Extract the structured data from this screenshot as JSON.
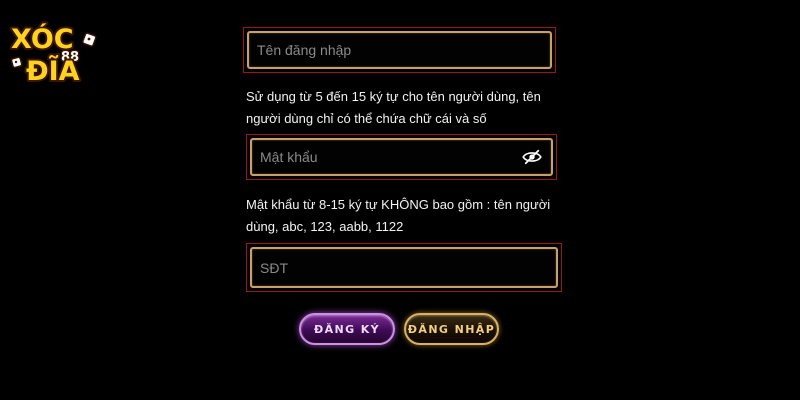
{
  "brand": {
    "logo_line1": "XÓC",
    "logo_badge": "88",
    "logo_line2": "ĐĨA"
  },
  "form": {
    "username": {
      "placeholder": "Tên đăng nhập",
      "value": "",
      "hint": "Sử dụng từ 5 đến 15 ký tự cho tên người dùng, tên người dùng chỉ có thể chứa chữ cái và số"
    },
    "password": {
      "placeholder": "Mật khẩu",
      "value": "",
      "hint": "Mật khẩu từ 8-15 ký tự KHÔNG bao gồm : tên người dùng, abc, 123, aabb, 1122",
      "toggle_icon": "eye-slash-icon"
    },
    "phone": {
      "placeholder": "SĐT",
      "value": ""
    }
  },
  "buttons": {
    "register": "ĐĂNG KÝ",
    "login": "ĐĂNG NHẬP"
  },
  "colors": {
    "background": "#000000",
    "field_outer_border": "#9a1812",
    "field_inner_border": "#c7a06a",
    "register_accent": "#a23fd0",
    "login_accent": "#d9b165",
    "logo_fill": "#ffd21f"
  }
}
